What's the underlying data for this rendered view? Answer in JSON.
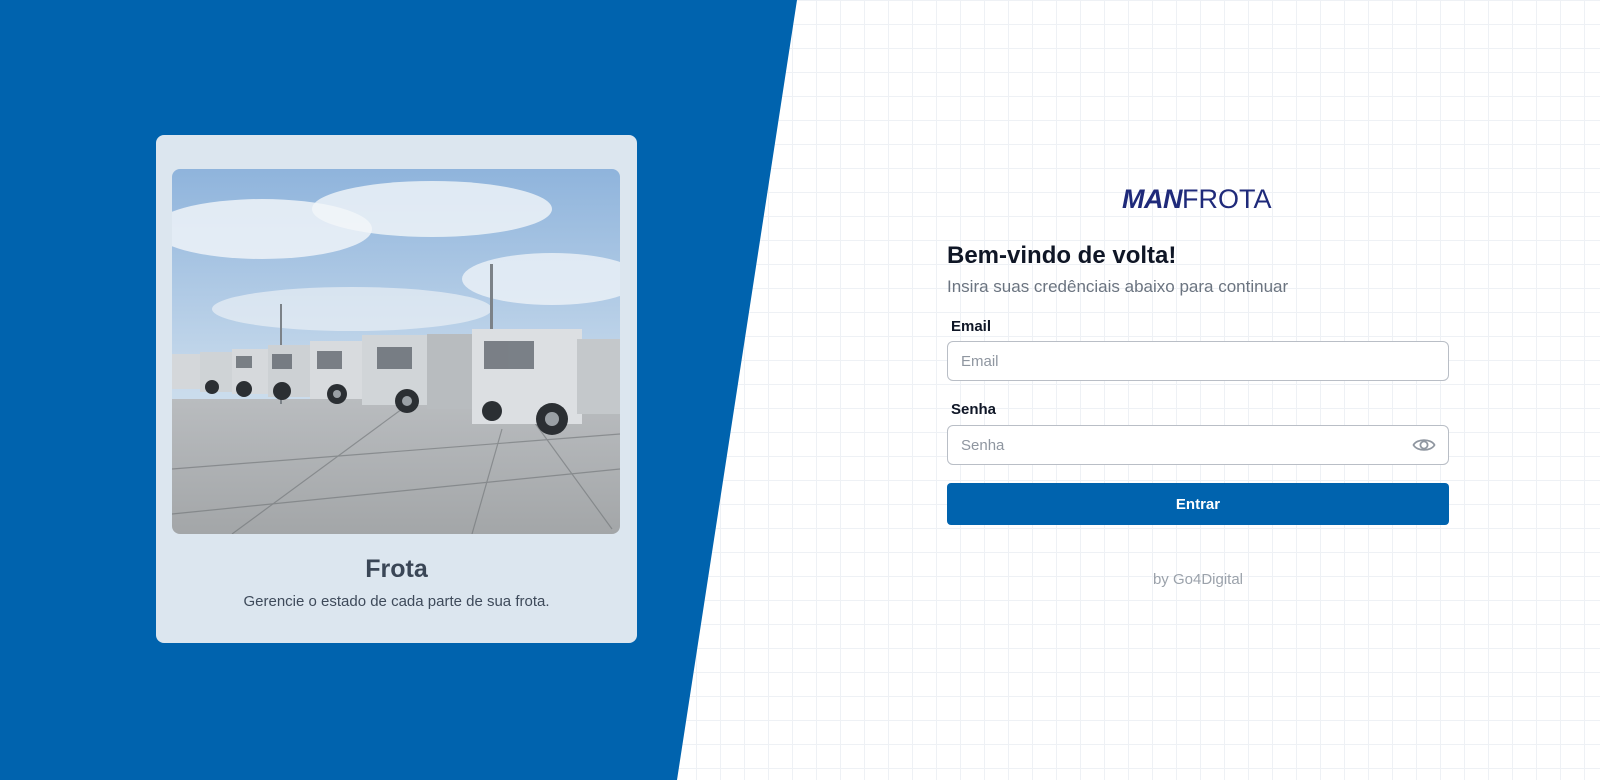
{
  "feature_card": {
    "title": "Frota",
    "subtitle": "Gerencie o estado de cada parte de sua frota.",
    "image_alt": "fleet-trucks-photo"
  },
  "login": {
    "logo_bold": "MAN",
    "logo_light": "FROTA",
    "heading": "Bem-vindo de volta!",
    "subheading": "Insira suas credênciais abaixo para continuar",
    "email_label": "Email",
    "email_placeholder": "Email",
    "email_value": "",
    "password_label": "Senha",
    "password_placeholder": "Senha",
    "password_value": "",
    "submit_label": "Entrar",
    "byline": "by Go4Digital"
  },
  "colors": {
    "brand_blue": "#0063ae",
    "logo_navy": "#1f2a7a",
    "card_bg": "#dce6ef"
  }
}
